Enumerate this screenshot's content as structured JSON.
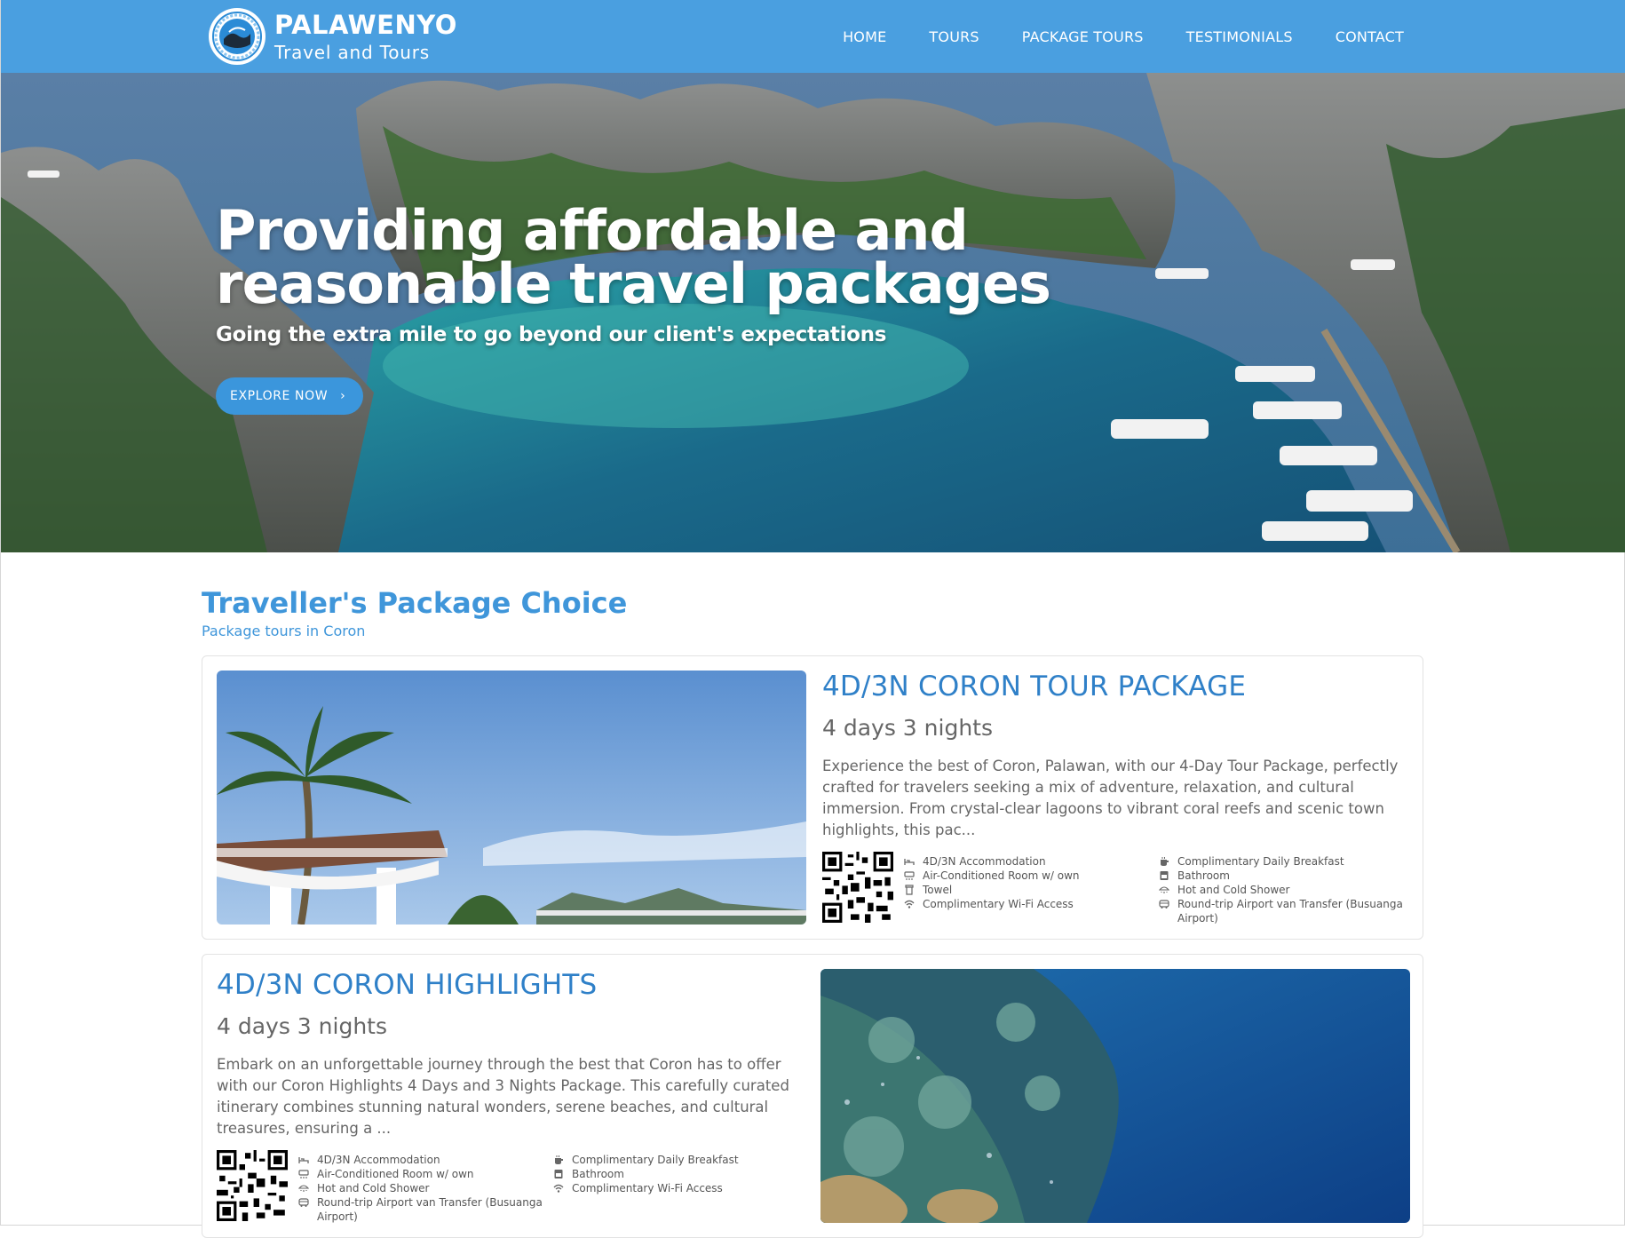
{
  "header": {
    "brand_name": "PALAWENYO",
    "brand_sub": "Travel and Tours",
    "nav": [
      "HOME",
      "TOURS",
      "PACKAGE TOURS",
      "TESTIMONIALS",
      "CONTACT"
    ]
  },
  "hero": {
    "title_line1": "Providing affordable and",
    "title_line2": "reasonable travel packages",
    "subtitle": "Going the extra mile to go beyond our client's expectations",
    "button_label": "EXPLORE NOW",
    "button_chevron": "›"
  },
  "section": {
    "title": "Traveller's Package Choice",
    "subtitle": "Package tours in Coron"
  },
  "packages": [
    {
      "title": "4D/3N CORON TOUR PACKAGE",
      "duration": "4 days 3 nights",
      "description": "Experience the best of Coron, Palawan, with our 4-Day Tour Package, perfectly crafted for travelers seeking a mix of adventure, relaxation, and cultural immersion. From crystal-clear lagoons to vibrant coral reefs and scenic town highlights, this pac...",
      "amenities_left": [
        "4D/3N Accommodation",
        "Air-Conditioned Room w/ own",
        "Towel",
        "Complimentary Wi-Fi Access"
      ],
      "amenities_right": [
        "Complimentary Daily Breakfast",
        "Bathroom",
        "Hot and Cold Shower",
        "Round-trip Airport van Transfer (Busuanga Airport)"
      ],
      "icons_left": [
        "bed-icon",
        "ac-icon",
        "towel-icon",
        "wifi-icon"
      ],
      "icons_right": [
        "breakfast-icon",
        "bathroom-icon",
        "shower-icon",
        "van-icon"
      ]
    },
    {
      "title": "4D/3N CORON HIGHLIGHTS",
      "duration": "4 days 3 nights",
      "description": "Embark on an unforgettable journey through the best that Coron has to offer with our Coron Highlights 4 Days and 3 Nights Package. This carefully curated itinerary combines stunning natural wonders, serene beaches, and cultural treasures, ensuring a ...",
      "amenities_left": [
        "4D/3N Accommodation",
        "Air-Conditioned Room w/ own",
        "Hot and Cold Shower",
        "Round-trip Airport van Transfer (Busuanga Airport)"
      ],
      "amenities_right": [
        "Complimentary Daily Breakfast",
        "Bathroom",
        "Complimentary Wi-Fi Access"
      ],
      "icons_left": [
        "bed-icon",
        "ac-icon",
        "shower-icon",
        "van-icon"
      ],
      "icons_right": [
        "breakfast-icon",
        "bathroom-icon",
        "wifi-icon"
      ]
    }
  ],
  "colors": {
    "header": "#4a9fe0",
    "accent": "#3f96da",
    "card_title": "#2f80c8"
  }
}
